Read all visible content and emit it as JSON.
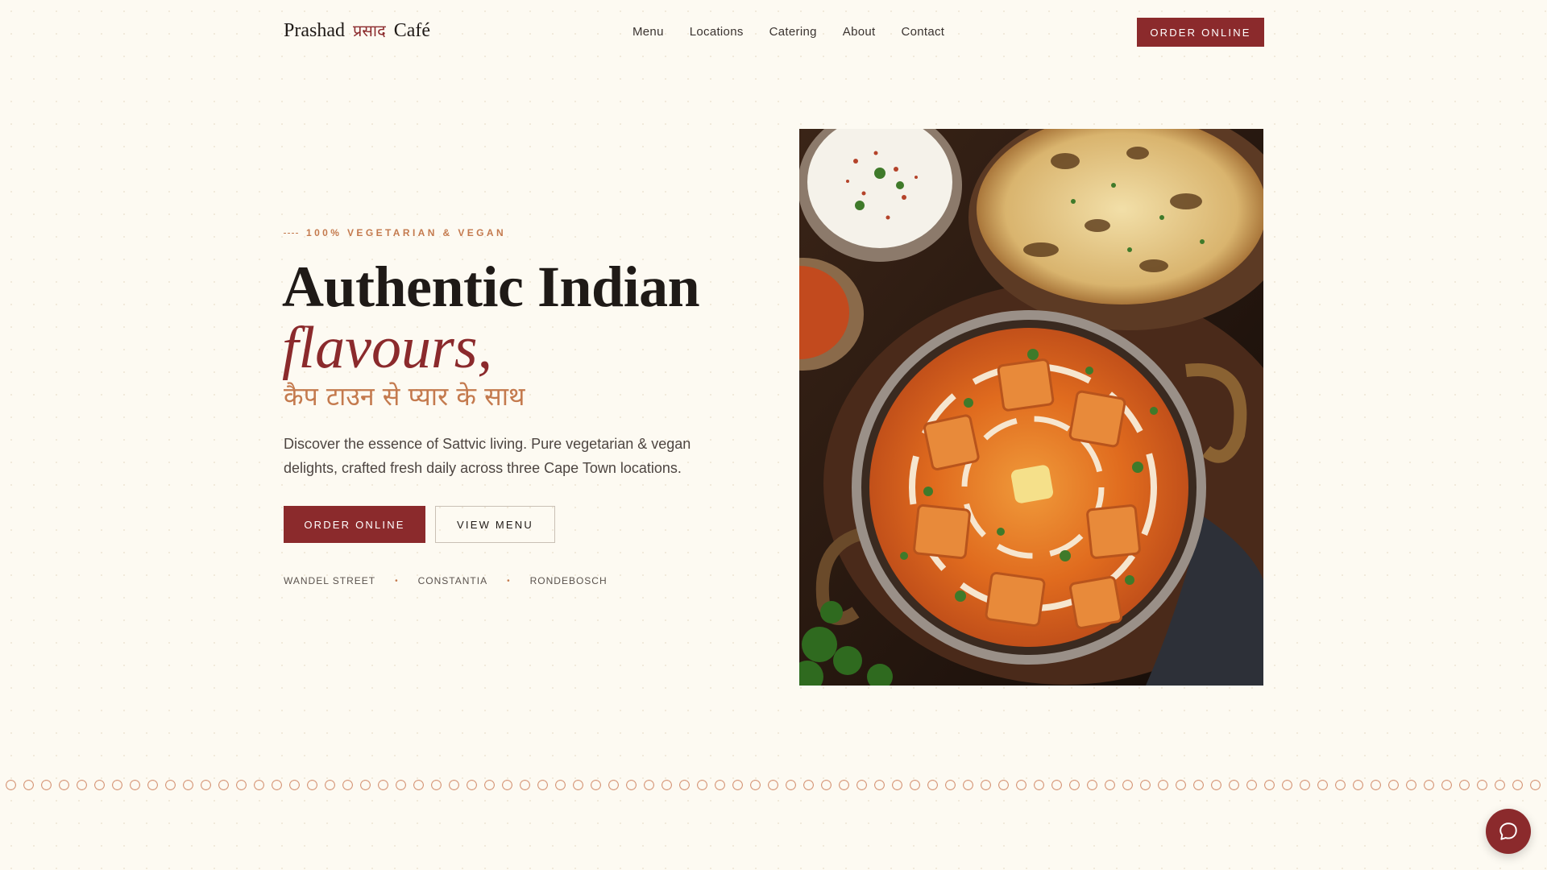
{
  "header": {
    "logo": {
      "name": "Prashad",
      "hindi": "प्रसाद",
      "suffix": "Café"
    },
    "nav": [
      {
        "label": "Menu"
      },
      {
        "label": "Locations"
      },
      {
        "label": "Catering"
      },
      {
        "label": "About"
      },
      {
        "label": "Contact"
      }
    ],
    "cta_label": "ORDER ONLINE"
  },
  "hero": {
    "eyebrow": "100% VEGETARIAN & VEGAN",
    "title_line1": "Authentic Indian",
    "title_line2": "flavours,",
    "title_hindi": "कैप टाउन से प्यार के साथ",
    "description": "Discover the essence of Sattvic living. Pure vegetarian & vegan delights, crafted fresh daily across three Cape Town locations.",
    "primary_button": "ORDER ONLINE",
    "secondary_button": "VIEW MENU",
    "locations": [
      "WANDEL STREET",
      "CONSTANTIA",
      "RONDEBOSCH"
    ],
    "image": {
      "icon": "paneer-curry-photo"
    }
  },
  "chat": {
    "icon": "chat-bubble-icon"
  },
  "colors": {
    "accent": "#8b2a2c",
    "secondary": "#c47a4e",
    "background": "#fdfaf2"
  }
}
